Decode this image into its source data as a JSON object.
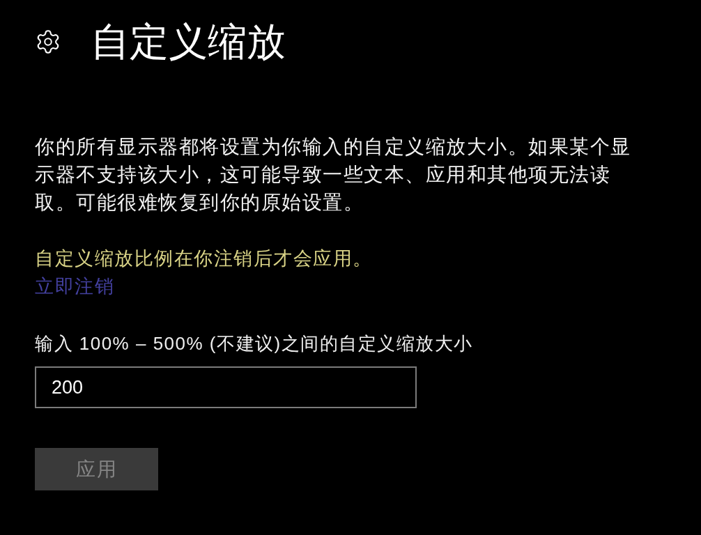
{
  "header": {
    "title": "自定义缩放"
  },
  "description": "你的所有显示器都将设置为你输入的自定义缩放大小。如果某个显示器不支持该大小，这可能导致一些文本、应用和其他项无法读取。可能很难恢复到你的原始设置。",
  "notice": {
    "text": "自定义缩放比例在你注销后才会应用。",
    "link": "立即注销"
  },
  "scale_field": {
    "label": "输入 100% – 500% (不建议)之间的自定义缩放大小",
    "value": "200"
  },
  "apply_button": {
    "label": "应用",
    "disabled": true
  }
}
